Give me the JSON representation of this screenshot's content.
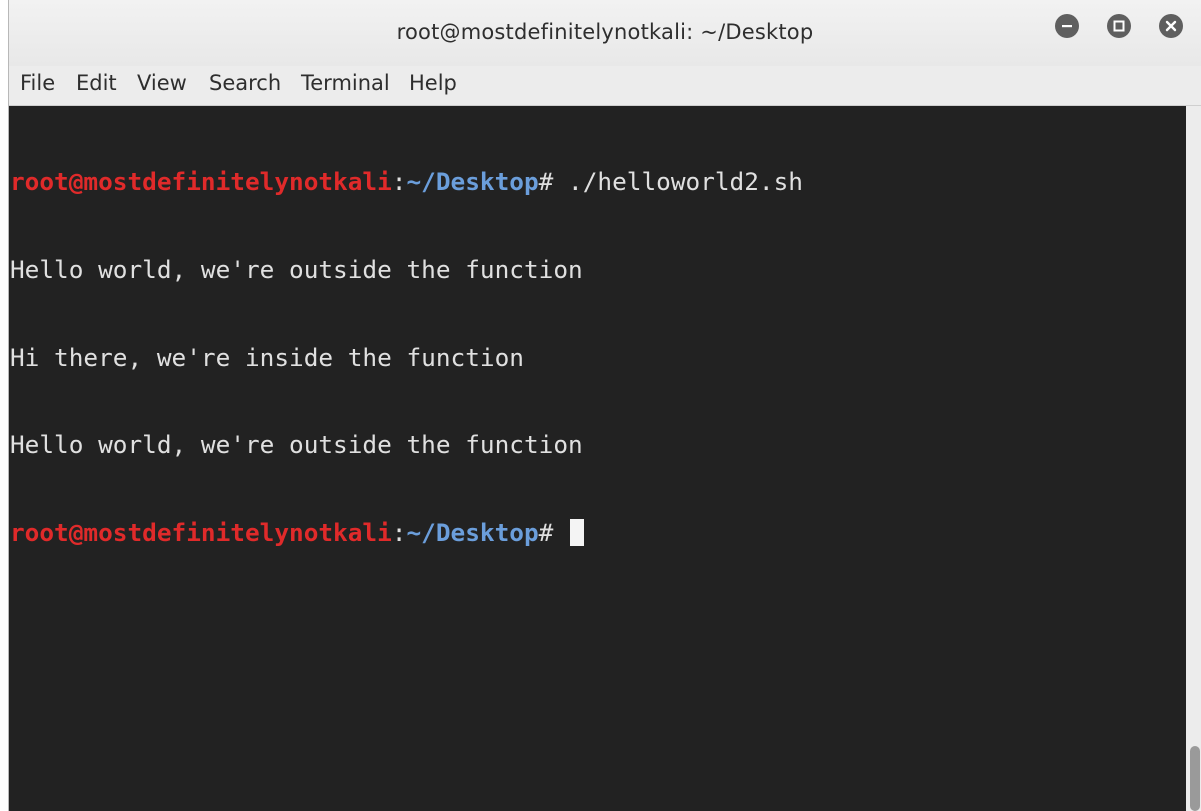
{
  "window": {
    "title": "root@mostdefinitelynotkali: ~/Desktop",
    "controls": [
      "minimize-icon",
      "maximize-icon",
      "close-icon"
    ]
  },
  "menubar": {
    "items": [
      "File",
      "Edit",
      "View",
      "Search",
      "Terminal",
      "Help"
    ]
  },
  "terminal": {
    "prompt_user": "root@mostdefinitelynotkali",
    "prompt_colon": ":",
    "prompt_path": "~/Desktop",
    "prompt_symbol": "# ",
    "command": "./helloworld2.sh",
    "output": [
      "Hello world, we're outside the function",
      "Hi there, we're inside the function",
      "Hello world, we're outside the function"
    ]
  },
  "colors": {
    "background": "#222222",
    "prompt_user": "#e02a2a",
    "prompt_path": "#6b9edb",
    "text": "#e0e0e0"
  }
}
